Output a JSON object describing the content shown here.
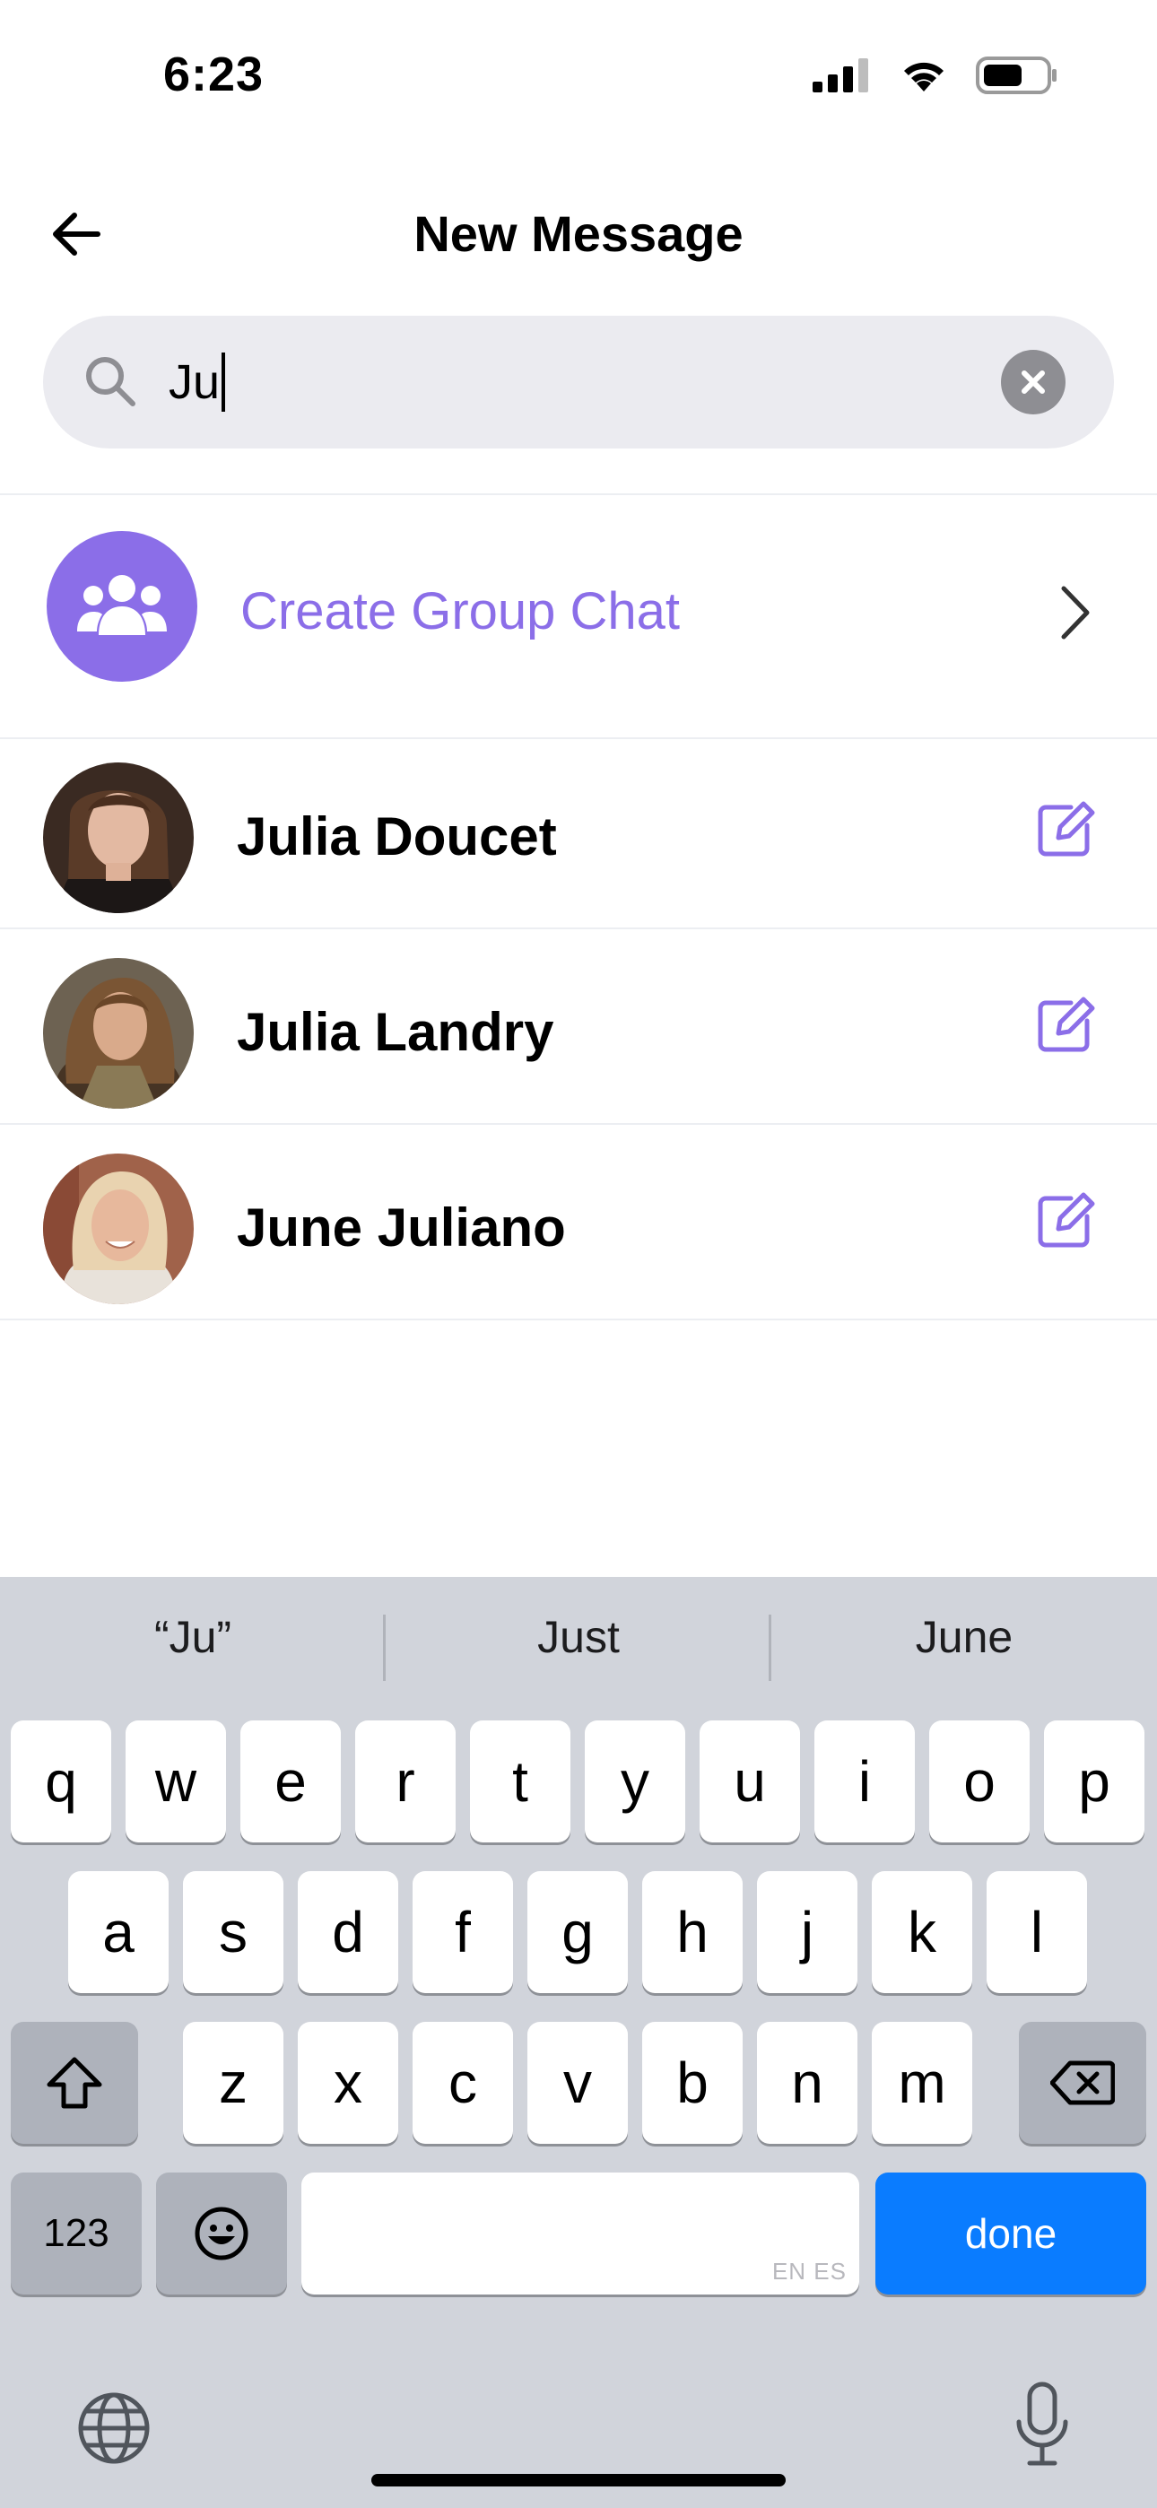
{
  "status": {
    "time": "6:23"
  },
  "header": {
    "title": "New Message"
  },
  "search": {
    "value": "Ju"
  },
  "group_chat": {
    "label": "Create Group Chat"
  },
  "contacts": [
    {
      "name": "Julia Doucet"
    },
    {
      "name": "Julia Landry"
    },
    {
      "name": "June Juliano"
    }
  ],
  "keyboard": {
    "suggestions": [
      "“Ju”",
      "Just",
      "June"
    ],
    "row1": [
      "q",
      "w",
      "e",
      "r",
      "t",
      "y",
      "u",
      "i",
      "o",
      "p"
    ],
    "row2": [
      "a",
      "s",
      "d",
      "f",
      "g",
      "h",
      "j",
      "k",
      "l"
    ],
    "row3": [
      "z",
      "x",
      "c",
      "v",
      "b",
      "n",
      "m"
    ],
    "numbers_key": "123",
    "space_hint": "EN ES",
    "done_key": "done"
  },
  "colors": {
    "accent": "#8b6ee8",
    "done_key": "#0a7cff"
  }
}
